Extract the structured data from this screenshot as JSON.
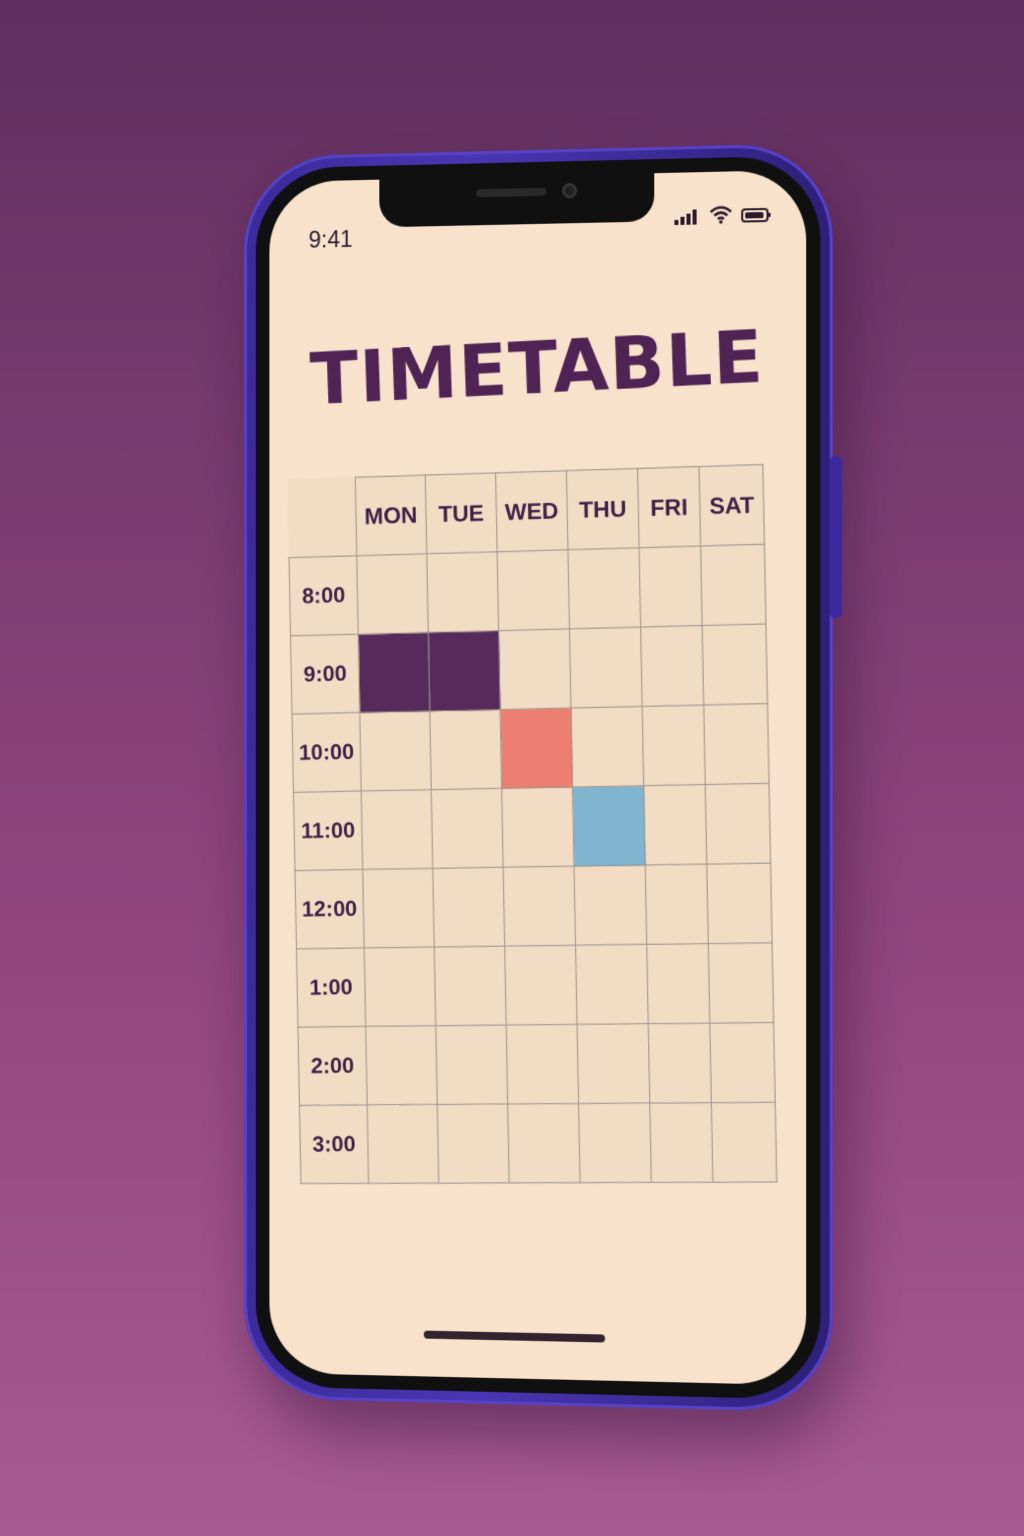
{
  "status_bar": {
    "time": "9:41"
  },
  "screen": {
    "title": "TIMETABLE"
  },
  "timetable": {
    "days": [
      "MON",
      "TUE",
      "WED",
      "THU",
      "FRI",
      "SAT"
    ],
    "times": [
      "8:00",
      "9:00",
      "10:00",
      "11:00",
      "12:00",
      "1:00",
      "2:00",
      "3:00"
    ],
    "highlighted_slots": [
      {
        "day": "MON",
        "time": "9:00",
        "color": "#562a5a"
      },
      {
        "day": "TUE",
        "time": "9:00",
        "color": "#562a5a"
      },
      {
        "day": "WED",
        "time": "10:00",
        "color": "#ed7f72"
      },
      {
        "day": "THU",
        "time": "11:00",
        "color": "#80b4cf"
      }
    ]
  },
  "icons": [
    "signal-icon",
    "wifi-icon",
    "battery-icon"
  ],
  "colors": {
    "background": "#8f4a80",
    "phone_frame": "#3f2ea6",
    "screen": "#f8e2cc",
    "title": "#4f2354",
    "grid": "#99908a"
  }
}
